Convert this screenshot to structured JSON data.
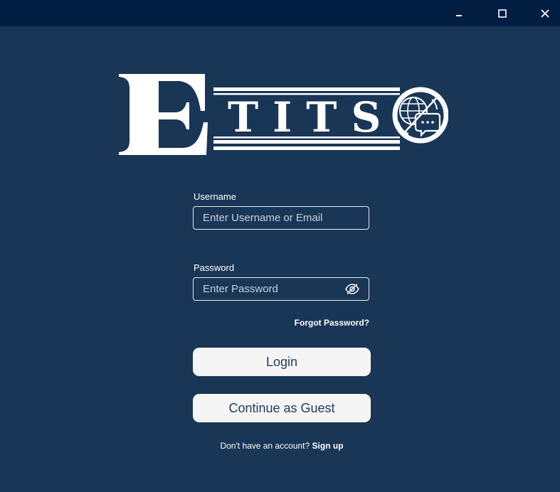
{
  "window": {
    "controls": {
      "minimize_icon": "minimize-icon",
      "maximize_icon": "maximize-icon",
      "close_icon": "close-icon"
    }
  },
  "logo": {
    "text": "ETITS",
    "icon": "globe-chat-icon"
  },
  "form": {
    "username": {
      "label": "Username",
      "placeholder": "Enter Username or Email",
      "value": ""
    },
    "password": {
      "label": "Password",
      "placeholder": "Enter Password",
      "value": "",
      "toggle_icon": "eye-slash-icon"
    },
    "forgot_password": "Forgot Password?",
    "login_label": "Login",
    "guest_label": "Continue as Guest",
    "signup_prompt": "Don't have an account?",
    "signup_link": "Sign up"
  },
  "colors": {
    "background": "#193656",
    "titlebar": "#011d42",
    "button_bg": "#f5f5f5",
    "button_text": "#1f3b5a"
  }
}
